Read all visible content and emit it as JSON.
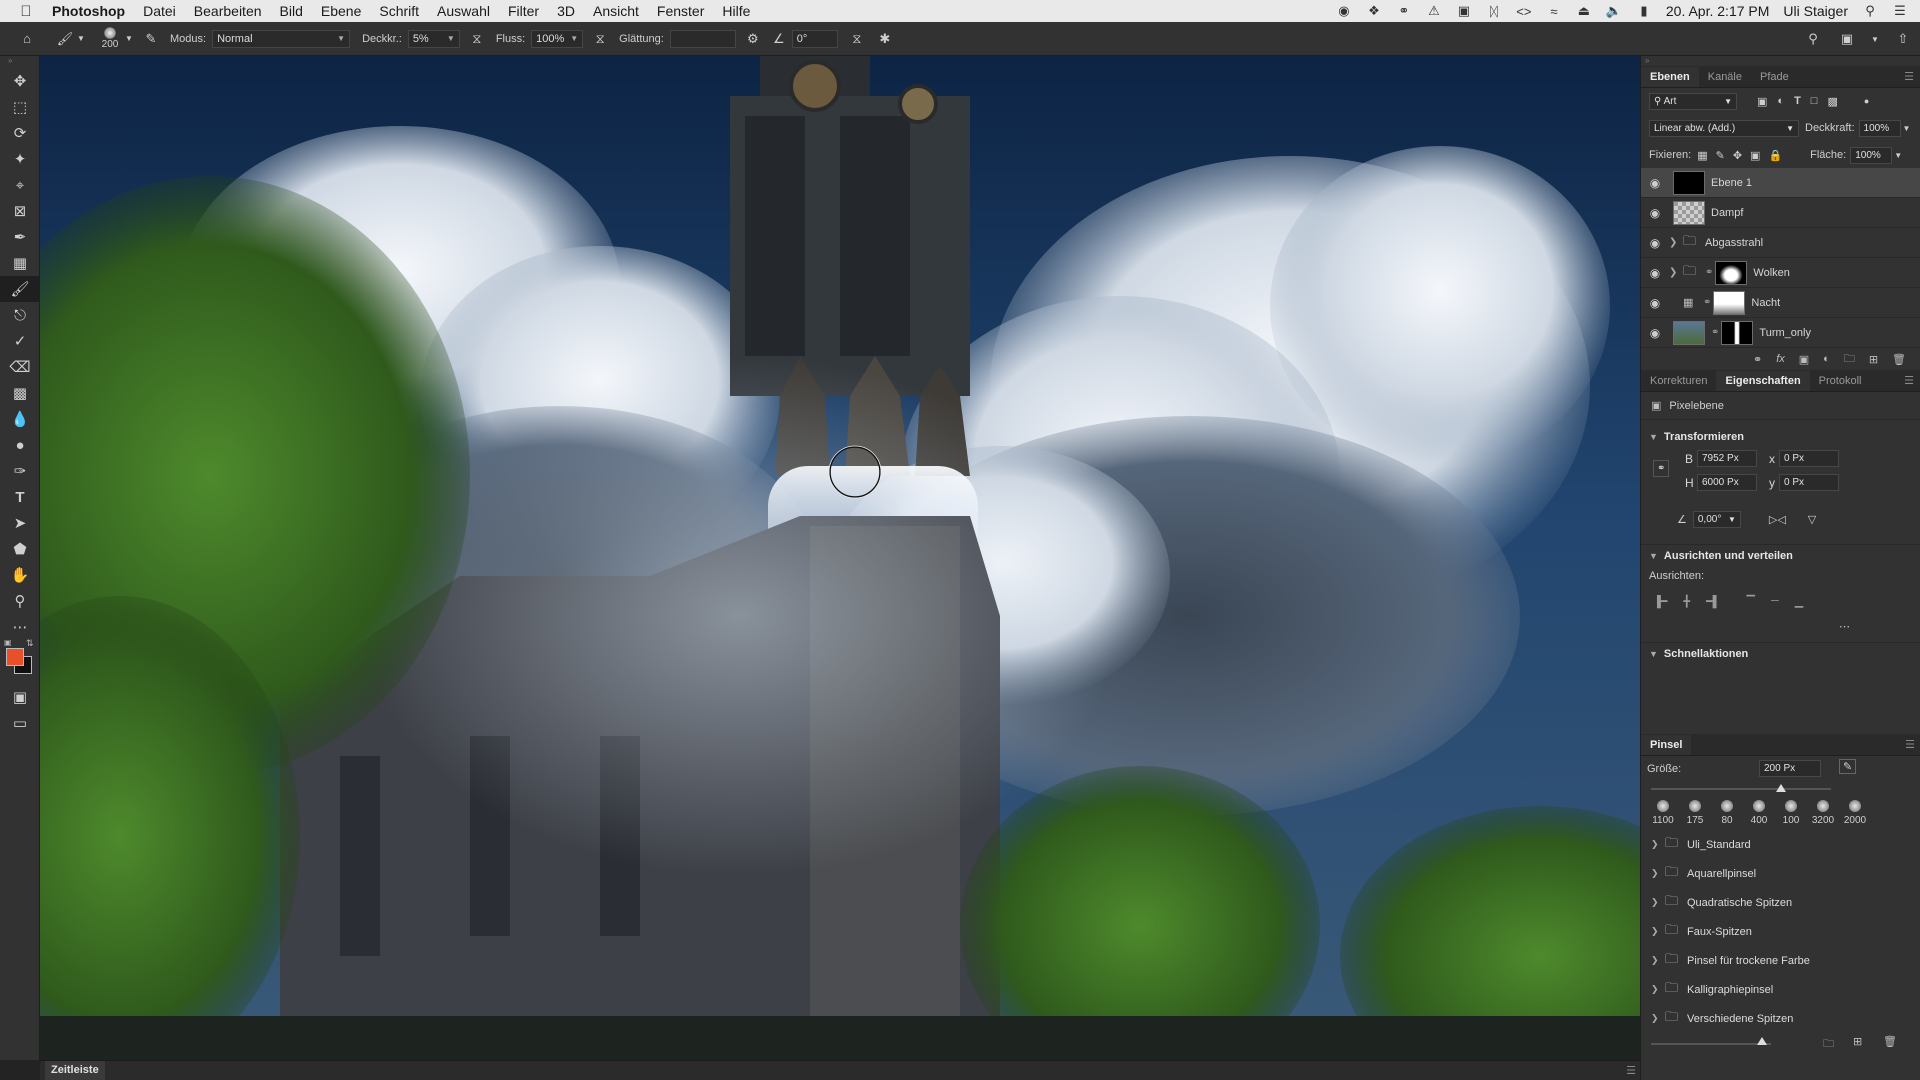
{
  "menubar": {
    "app_name": "Photoshop",
    "items": [
      "Datei",
      "Bearbeiten",
      "Bild",
      "Ebene",
      "Schrift",
      "Auswahl",
      "Filter",
      "3D",
      "Ansicht",
      "Fenster",
      "Hilfe"
    ],
    "datetime": "20. Apr.  2:17 PM",
    "user": "Uli Staiger"
  },
  "options": {
    "brush_size": "200",
    "mode_label": "Modus:",
    "mode_value": "Normal",
    "opacity_label": "Deckkr.:",
    "opacity_value": "5%",
    "flow_label": "Fluss:",
    "flow_value": "100%",
    "smoothing_label": "Glättung:",
    "smoothing_value": "",
    "angle_value": "0°"
  },
  "layers_panel": {
    "tabs": [
      "Ebenen",
      "Kanäle",
      "Pfade"
    ],
    "filter_label": "Art",
    "blend_mode": "Linear abw. (Add.)",
    "opacity_label": "Deckkraft:",
    "opacity_value": "100%",
    "lock_label": "Fixieren:",
    "fill_label": "Fläche:",
    "fill_value": "100%",
    "layers": [
      {
        "name": "Ebene 1"
      },
      {
        "name": "Dampf"
      },
      {
        "name": "Abgasstrahl"
      },
      {
        "name": "Wolken"
      },
      {
        "name": "Nacht"
      },
      {
        "name": "Turm_only"
      }
    ]
  },
  "properties_panel": {
    "tabs": [
      "Korrekturen",
      "Eigenschaften",
      "Protokoll"
    ],
    "type_label": "Pixelebene",
    "transform_title": "Transformieren",
    "w_label": "B",
    "w_value": "7952 Px",
    "h_label": "H",
    "h_value": "6000 Px",
    "x_label": "x",
    "x_value": "0 Px",
    "y_label": "y",
    "y_value": "0 Px",
    "angle_value": "0,00°",
    "align_title": "Ausrichten und verteilen",
    "align_label": "Ausrichten:",
    "quick_title": "Schnellaktionen"
  },
  "brush_panel": {
    "title": "Pinsel",
    "size_label": "Größe:",
    "size_value": "200 Px",
    "size_slider_fraction": 0.72,
    "presets": [
      "1100",
      "175",
      "80",
      "400",
      "100",
      "3200",
      "2000"
    ],
    "folders": [
      "Uli_Standard",
      "Aquarellpinsel",
      "Quadratische Spitzen",
      "Faux-Spitzen",
      "Pinsel für trockene Farbe",
      "Kalligraphiepinsel",
      "Verschiedene Spitzen"
    ]
  },
  "timeline": {
    "label": "Zeitleiste"
  },
  "colors": {
    "foreground": "#e8502a",
    "background": "#111111"
  }
}
